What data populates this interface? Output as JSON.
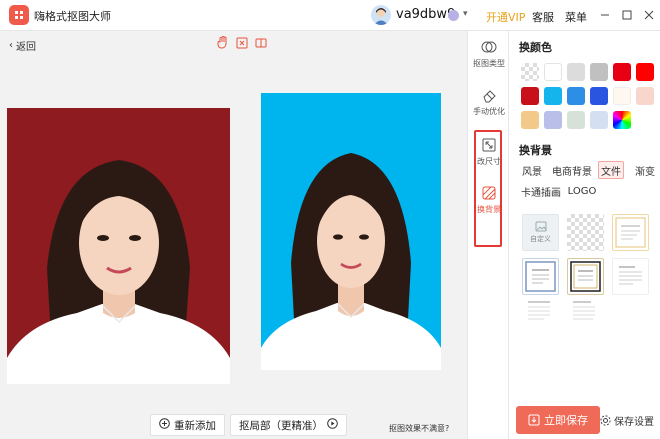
{
  "app": {
    "title": "嗨格式抠图大师",
    "username": "va9dbw9",
    "open_vip": "开通VIP",
    "customer_service": "客服",
    "menu": "菜单",
    "logo_icon": "app-logo-icon",
    "window_icons": [
      "minimize-icon",
      "maximize-icon",
      "close-icon"
    ]
  },
  "editor": {
    "back_label": "返回",
    "toolbar_icons": [
      "hand-icon",
      "fit-screen-icon",
      "compare-icon"
    ],
    "add_new": "重新添加",
    "local_cutout": "抠局部（更精准）",
    "not_satisfied": "抠图效果不满意?",
    "left_background": "#8e1b1f",
    "right_background": "#00b4ee"
  },
  "strip": {
    "items": [
      {
        "label": "抠图类型",
        "icon": "cutout-type-icon"
      },
      {
        "label": "手动优化",
        "icon": "eraser-icon"
      },
      {
        "label": "改尺寸",
        "icon": "resize-icon"
      },
      {
        "label": "换背景",
        "icon": "background-icon"
      }
    ],
    "highlight_color": "#e53935"
  },
  "panel": {
    "color_heading": "换颜色",
    "swatches": [
      "transparent",
      "#ffffff",
      "#dcdcdc",
      "#c0c0c0",
      "#e60012",
      "#ff0000",
      "#c8101a",
      "#16b4ec",
      "#2e8ee6",
      "#2a55e0",
      "#fff8f0",
      "#f8d6cc",
      "#f3c98a",
      "#b9bfe8",
      "#d6e2d8",
      "#d4dff2",
      "rainbow"
    ],
    "bg_heading": "换背景",
    "bg_tabs": [
      "风景",
      "电商背景",
      "文件",
      "渐变",
      "卡通插画",
      "LOGO"
    ],
    "active_tab": "文件",
    "custom_label": "自定义",
    "save_now": "立即保存",
    "save_settings": "保存设置",
    "accent": "#f06a58"
  }
}
